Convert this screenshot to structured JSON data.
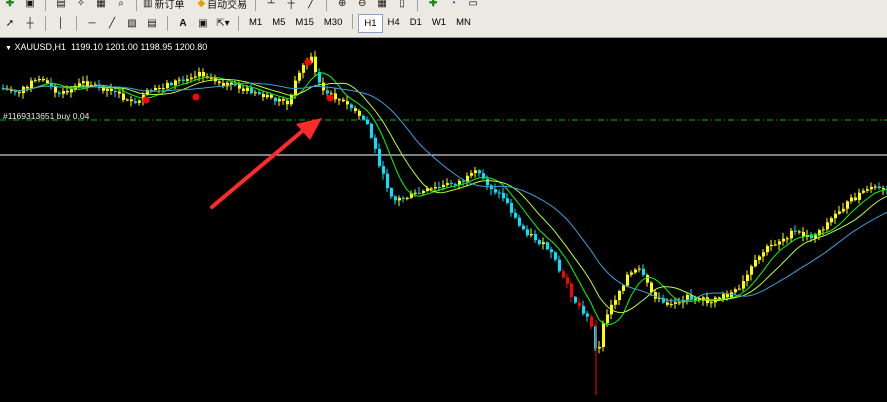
{
  "toolbar": {
    "row1": {
      "new_order_label": "新订单",
      "autotrading_label": "自动交易"
    },
    "timeframes": [
      {
        "label": "M1",
        "active": false
      },
      {
        "label": "M5",
        "active": false
      },
      {
        "label": "M15",
        "active": false
      },
      {
        "label": "M30",
        "active": false
      },
      {
        "label": "H1",
        "active": true
      },
      {
        "label": "H4",
        "active": false
      },
      {
        "label": "D1",
        "active": false
      },
      {
        "label": "W1",
        "active": false
      },
      {
        "label": "MN",
        "active": false
      }
    ]
  },
  "chart": {
    "symbol": "XAUUSD,H1",
    "ohlc": "1199.10 1201.00 1198.95 1200.80",
    "order_label": "#1169313651 buy 0.04",
    "colors": {
      "background": "#000000",
      "bull_candle": "#ffff00",
      "bear_candle": "#00e5ff",
      "drop_candle": "#ff0000",
      "ma_fast": "#00ff00",
      "ma_mid": "#b4ff32",
      "ma_slow": "#3ca0dc",
      "order_line": "#00c000",
      "horizontal_line": "#ffffff",
      "arrow": "#ff2a2a",
      "marker": "#ff0000"
    },
    "icons": [
      "cursor-icon",
      "crosshair-icon",
      "vertical-line-icon",
      "horizontal-line-icon",
      "trendline-icon",
      "channel-icon",
      "fibonacci-icon",
      "text-icon",
      "label-icon",
      "arrows-icon",
      "new-order-icon",
      "autotrading-icon",
      "chart-icon"
    ]
  }
}
